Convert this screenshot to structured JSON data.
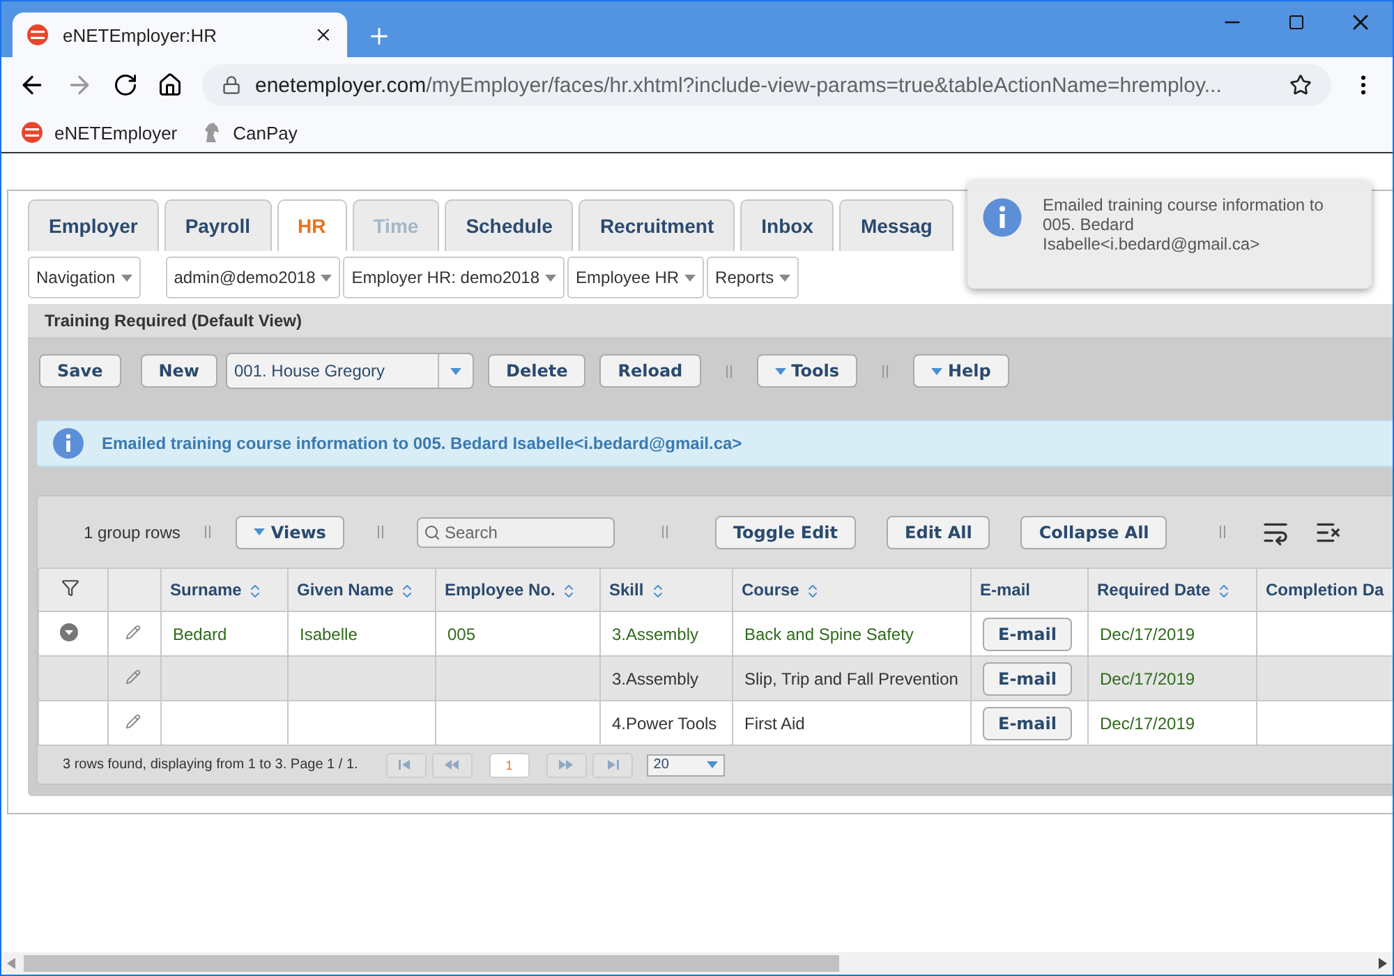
{
  "browser": {
    "tab_title": "eNETEmployer:HR",
    "url_domain": "enetemployer.com",
    "url_path": "/myEmployer/faces/hr.xhtml?include-view-params=true&tableActionName=hremploy...",
    "bookmarks": [
      "eNETEmployer",
      "CanPay"
    ]
  },
  "tabs": [
    {
      "label": "Employer",
      "selected": false,
      "disabled": false
    },
    {
      "label": "Payroll",
      "selected": false,
      "disabled": false
    },
    {
      "label": "HR",
      "selected": true,
      "disabled": false
    },
    {
      "label": "Time",
      "selected": false,
      "disabled": true
    },
    {
      "label": "Schedule",
      "selected": false,
      "disabled": false
    },
    {
      "label": "Recruitment",
      "selected": false,
      "disabled": false
    },
    {
      "label": "Inbox",
      "selected": false,
      "disabled": false
    },
    {
      "label": "Messag",
      "selected": false,
      "disabled": false
    }
  ],
  "nav_menus": [
    "Navigation",
    "admin@demo2018",
    "Employer HR: demo2018",
    "Employee HR",
    "Reports"
  ],
  "panel_title": "Training Required (Default View)",
  "toolbar": {
    "save": "Save",
    "new": "New",
    "employee_select": "001. House Gregory",
    "delete": "Delete",
    "reload": "Reload",
    "tools": "Tools",
    "help": "Help"
  },
  "info_message": "Emailed training course information to 005. Bedard Isabelle<i.bedard@gmail.ca>",
  "table_toolbar": {
    "group_rows": "1 group rows",
    "views": "Views",
    "search_placeholder": "Search",
    "toggle_edit": "Toggle Edit",
    "edit_all": "Edit All",
    "collapse_all": "Collapse All"
  },
  "table": {
    "columns": [
      {
        "label": "Surname",
        "sortable": true
      },
      {
        "label": "Given Name",
        "sortable": true
      },
      {
        "label": "Employee No.",
        "sortable": true
      },
      {
        "label": "Skill",
        "sortable": true
      },
      {
        "label": "Course",
        "sortable": true
      },
      {
        "label": "E-mail",
        "sortable": false
      },
      {
        "label": "Required Date",
        "sortable": true
      },
      {
        "label": "Completion Da"
      }
    ],
    "rows": [
      {
        "kind": "group",
        "shaded": false,
        "cells": [
          "Bedard",
          "Isabelle",
          "005",
          "3.Assembly",
          "Back and Spine Safety",
          "E-mail",
          "Dec/17/2019",
          ""
        ]
      },
      {
        "kind": "detail",
        "shaded": true,
        "cells": [
          "",
          "",
          "",
          "3.Assembly",
          "Slip, Trip and Fall Prevention",
          "E-mail",
          "Dec/17/2019",
          ""
        ]
      },
      {
        "kind": "detail",
        "shaded": false,
        "cells": [
          "",
          "",
          "",
          "4.Power Tools",
          "First Aid",
          "E-mail",
          "Dec/17/2019",
          ""
        ]
      }
    ],
    "footer": "3 rows found, displaying from 1 to 3. Page 1 / 1.",
    "page": "1",
    "page_size": "20"
  },
  "toast": {
    "lines": [
      "Emailed training course information to",
      "005. Bedard",
      "Isabelle<i.bedard@gmail.ca>"
    ]
  }
}
